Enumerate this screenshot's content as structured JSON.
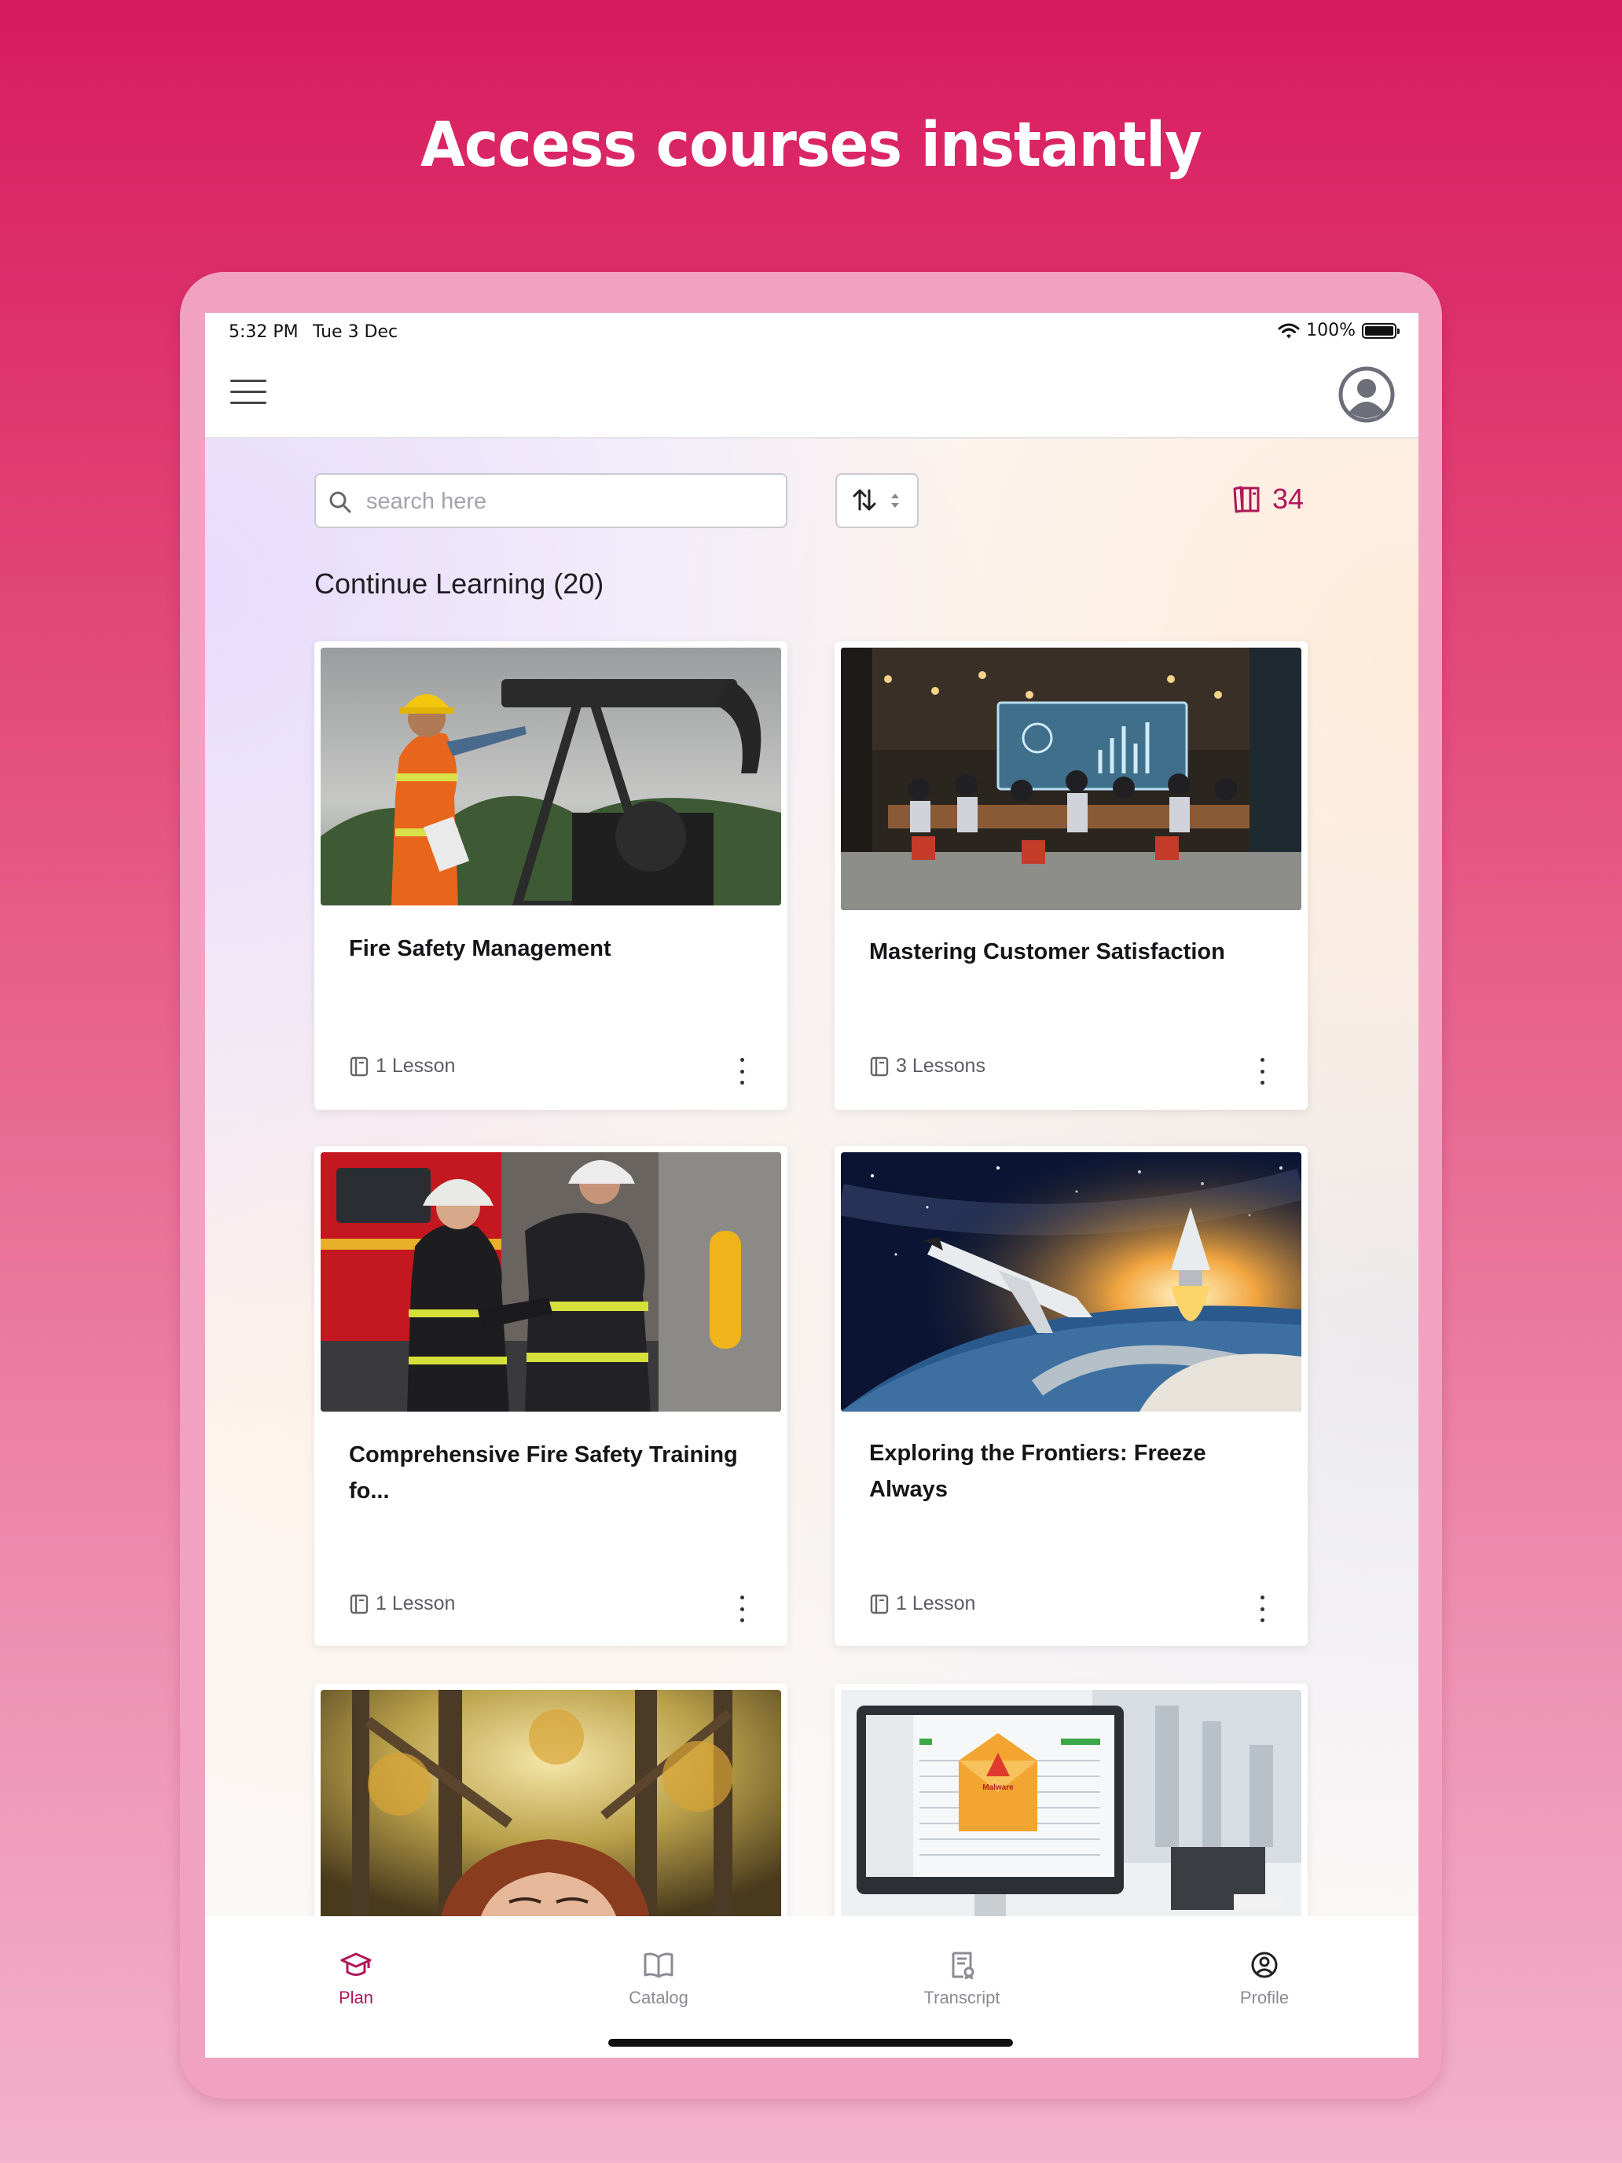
{
  "headline": "Access courses instantly",
  "status": {
    "time": "5:32 PM",
    "date": "Tue 3 Dec",
    "battery": "100%"
  },
  "search": {
    "placeholder": "search here"
  },
  "course_count": "34",
  "section_title": "Continue Learning (20)",
  "courses": [
    {
      "title": "Fire Safety Management",
      "lessons": "1 Lesson"
    },
    {
      "title": "Mastering Customer Satisfaction",
      "lessons": "3 Lessons"
    },
    {
      "title": "Comprehensive Fire Safety Training fo...",
      "lessons": "1 Lesson"
    },
    {
      "title": "Exploring the Frontiers: Freeze Always",
      "lessons": "1 Lesson"
    }
  ],
  "malware_label": "Malware",
  "tabs": [
    {
      "label": "Plan",
      "icon": "graduation-cap-icon",
      "active": true
    },
    {
      "label": "Catalog",
      "icon": "book-open-icon",
      "active": false
    },
    {
      "label": "Transcript",
      "icon": "certificate-icon",
      "active": false
    },
    {
      "label": "Profile",
      "icon": "user-circle-icon",
      "active": false
    }
  ],
  "colors": {
    "accent": "#b0165a",
    "background_top": "#d81b5d",
    "background_bottom": "#f2b3cb",
    "frame": "#f1a2c0"
  }
}
